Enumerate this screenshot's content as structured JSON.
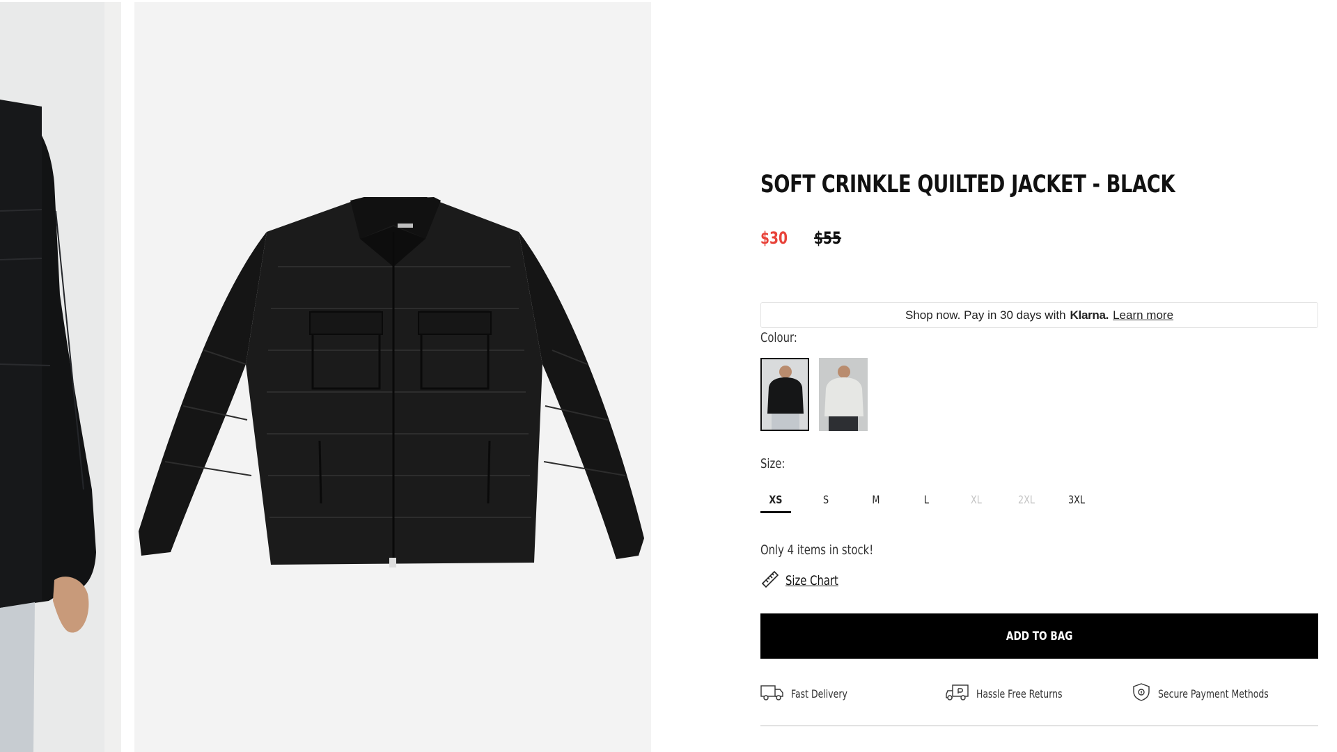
{
  "gallery": {
    "images": [
      {
        "alt": "Model wearing jacket"
      },
      {
        "alt": "Soft crinkle quilted jacket flat lay"
      }
    ]
  },
  "product": {
    "title": "SOFT CRINKLE QUILTED JACKET - BLACK",
    "price_now": "$30",
    "price_was": "$55"
  },
  "klarna": {
    "text": "Shop now. Pay in 30 days with",
    "brand": "Klarna.",
    "link": "Learn more"
  },
  "colour": {
    "label": "Colour:",
    "options": [
      {
        "name": "Black",
        "selected": true
      },
      {
        "name": "Grey",
        "selected": false
      }
    ]
  },
  "size": {
    "label": "Size:",
    "options": [
      {
        "label": "XS",
        "state": "selected"
      },
      {
        "label": "S",
        "state": "available"
      },
      {
        "label": "M",
        "state": "available"
      },
      {
        "label": "L",
        "state": "available"
      },
      {
        "label": "XL",
        "state": "unavailable"
      },
      {
        "label": "2XL",
        "state": "unavailable"
      },
      {
        "label": "3XL",
        "state": "available"
      }
    ]
  },
  "stock": {
    "text": "Only 4 items in stock!"
  },
  "size_chart": {
    "label": "Size Chart"
  },
  "cart": {
    "add_label": "ADD TO BAG"
  },
  "features": [
    {
      "icon": "truck-icon",
      "label": "Fast Delivery"
    },
    {
      "icon": "returns-icon",
      "label": "Hassle Free Returns"
    },
    {
      "icon": "shield-icon",
      "label": "Secure Payment Methods"
    }
  ],
  "colors": {
    "sale": "#e8433a",
    "button": "#000000",
    "text": "#111111"
  }
}
